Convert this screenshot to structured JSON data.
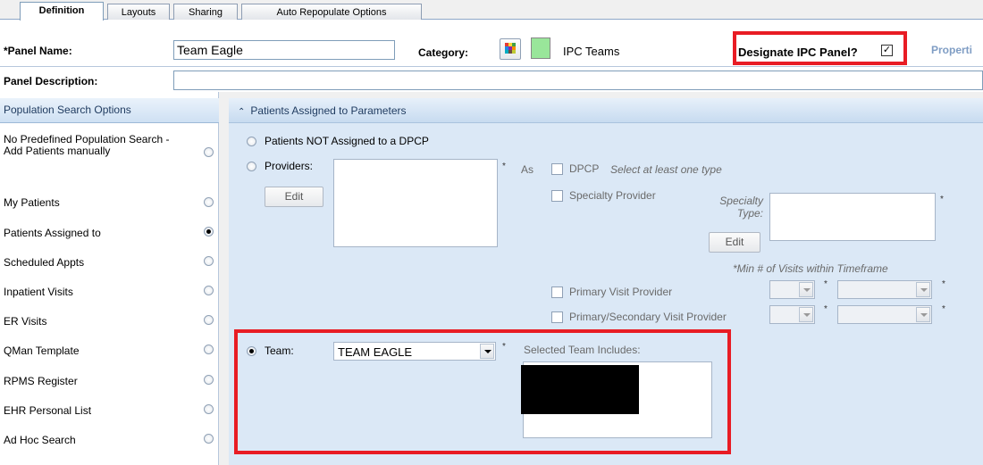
{
  "tabs": [
    {
      "label": "Definition"
    },
    {
      "label": "Layouts"
    },
    {
      "label": "Sharing"
    },
    {
      "label": "Auto Repopulate Options"
    }
  ],
  "header": {
    "panel_name_label": "*Panel Name:",
    "panel_name_value": "Team Eagle",
    "category_label": "Category:",
    "category_value": "IPC Teams",
    "category_color": "#99e69a",
    "designate_label": "Designate IPC Panel?",
    "designate_checked": "✓",
    "properties_label": "Properti",
    "panel_description_label": "Panel Description:",
    "panel_description_value": ""
  },
  "left": {
    "title": "Population Search Options",
    "options": [
      {
        "label": "No Predefined Population Search - Add Patients manually",
        "selected": false
      },
      {
        "label": "My Patients",
        "selected": false
      },
      {
        "label": "Patients Assigned to",
        "selected": true
      },
      {
        "label": "Scheduled Appts",
        "selected": false
      },
      {
        "label": "Inpatient Visits",
        "selected": false
      },
      {
        "label": "ER Visits",
        "selected": false
      },
      {
        "label": "QMan Template",
        "selected": false
      },
      {
        "label": "RPMS Register",
        "selected": false
      },
      {
        "label": "EHR Personal List",
        "selected": false
      },
      {
        "label": "Ad Hoc Search",
        "selected": false
      }
    ]
  },
  "right": {
    "title": "Patients Assigned to Parameters",
    "not_assigned_label": "Patients NOT Assigned to a DPCP",
    "providers_label": "Providers:",
    "edit_label": "Edit",
    "star": "*",
    "as_label": "As",
    "dpcp_label": "DPCP",
    "dpcp_hint": "Select at least one type",
    "specialty_provider_label": "Specialty Provider",
    "specialty_type_label_1": "Specialty",
    "specialty_type_label_2": "Type:",
    "min_visits_label": "*Min # of Visits within Timeframe",
    "primary_visit_label": "Primary Visit Provider",
    "primary_secondary_label": "Primary/Secondary Visit Provider",
    "team_label": "Team:",
    "team_value": "TEAM EAGLE",
    "selected_team_label": "Selected Team Includes:"
  }
}
